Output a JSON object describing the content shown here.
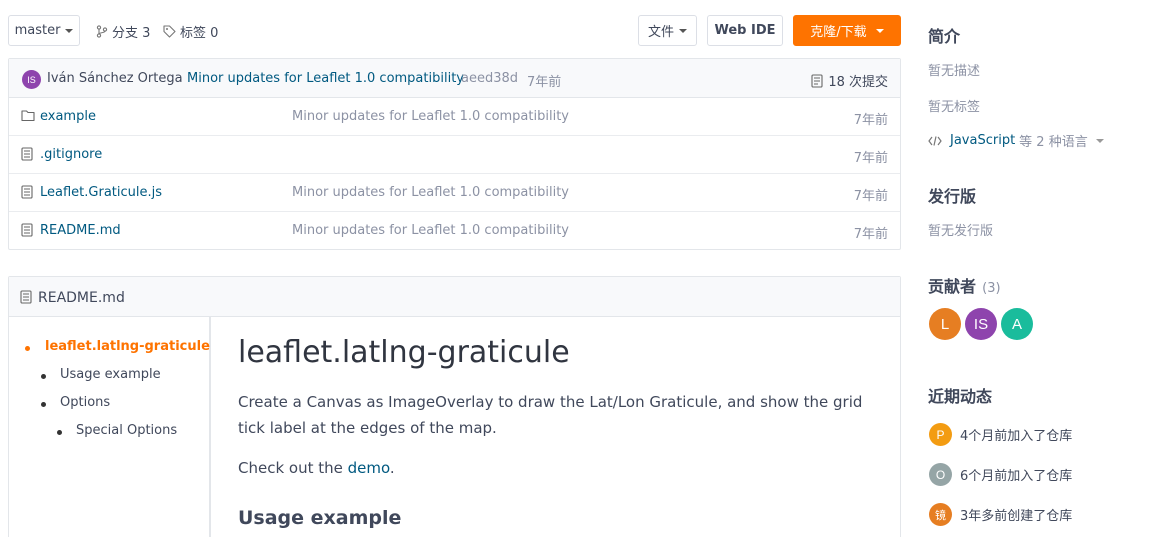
{
  "toolbar": {
    "branch": "master",
    "branches_label": "分支 3",
    "tags_label": "标签 0",
    "file_button": "文件",
    "webide_button": "Web IDE",
    "clone_button": "克隆/下载"
  },
  "commit": {
    "avatar_initials": "IS",
    "author": "Iván Sánchez Ortega",
    "message": "Minor updates for Leaflet 1.0 compatibility",
    "hash": "aeed38d",
    "time": "7年前",
    "count_label": "18 次提交"
  },
  "files": [
    {
      "name": "example",
      "type": "folder",
      "message": "Minor updates for Leaflet 1.0 compatibility",
      "time": "7年前"
    },
    {
      "name": ".gitignore",
      "type": "file",
      "message": "",
      "time": "7年前"
    },
    {
      "name": "Leaflet.Graticule.js",
      "type": "file",
      "message": "Minor updates for Leaflet 1.0 compatibility",
      "time": "7年前"
    },
    {
      "name": "README.md",
      "type": "file",
      "message": "Minor updates for Leaflet 1.0 compatibility",
      "time": "7年前"
    }
  ],
  "readme": {
    "filename": "README.md",
    "toc": [
      {
        "label": "leaflet.latlng-graticule",
        "active": true
      },
      {
        "label": "Usage example"
      },
      {
        "label": "Options"
      },
      {
        "label": "Special Options"
      }
    ],
    "title": "leaflet.latlng-graticule",
    "intro": "Create a Canvas as ImageOverlay to draw the Lat/Lon Graticule, and show the grid tick label at the edges of the map.",
    "checkout_prefix": "Check out the ",
    "checkout_link": "demo",
    "checkout_suffix": ".",
    "h2_usage": "Usage example"
  },
  "sidebar": {
    "intro_heading": "简介",
    "no_description": "暂无描述",
    "no_tags": "暂无标签",
    "language_link": "JavaScript",
    "language_more": "等 2 种语言",
    "releases_heading": "发行版",
    "no_releases": "暂无发行版",
    "contributors_heading": "贡献者",
    "contributors_count": "(3)",
    "contributors": [
      {
        "initials": "L",
        "color": "#e67e22"
      },
      {
        "initials": "IS",
        "color": "#8e44ad"
      },
      {
        "initials": "A",
        "color": "#1abc9c"
      }
    ],
    "activity_heading": "近期动态",
    "activity": [
      {
        "initial": "P",
        "color": "#f39c12",
        "text": "4个月前加入了仓库"
      },
      {
        "initial": "O",
        "color": "#95a5a6",
        "text": "6个月前加入了仓库"
      },
      {
        "initial": "镜",
        "color": "#e67e22",
        "text": "3年多前创建了仓库"
      }
    ]
  },
  "colors": {
    "accent": "#fe7300",
    "link": "#005980"
  }
}
